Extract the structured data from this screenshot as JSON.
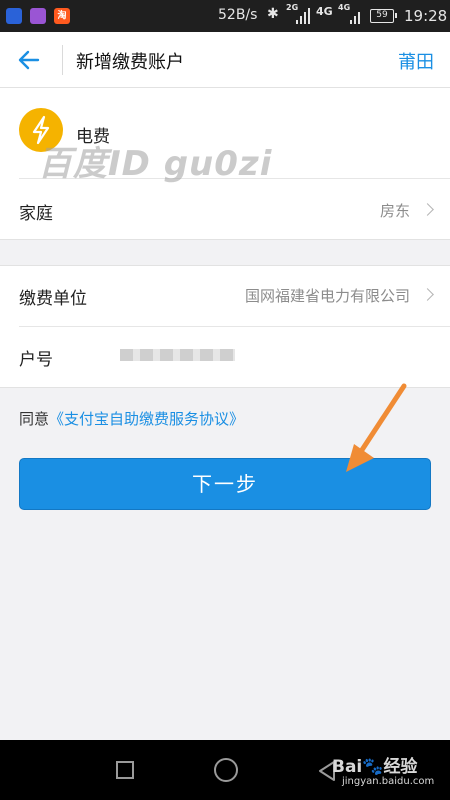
{
  "status_bar": {
    "app_badges": [
      "",
      "",
      "淘"
    ],
    "net_speed": "52B/s",
    "net_2g": "2G",
    "net_4g_a": "4G",
    "net_4g_b": "4G",
    "battery": "59",
    "time": "19:28"
  },
  "header": {
    "title": "新增缴费账户",
    "city": "莆田"
  },
  "bill": {
    "type": "电费",
    "icon": "lightning-bolt-icon",
    "icon_color": "#f5b300"
  },
  "watermark": "百度ID gu0zi",
  "rows": {
    "group_label": "家庭",
    "group_value": "房东",
    "unit_label": "缴费单位",
    "unit_value": "国网福建省电力有限公司",
    "account_label": "户号"
  },
  "agreement": {
    "prefix": "同意",
    "link": "《支付宝自助缴费服务协议》"
  },
  "next_button": "下一步",
  "footer_logo": {
    "brand": "Bai",
    "brand_suffix": "经验",
    "url": "jingyan.baidu.com"
  },
  "colors": {
    "accent": "#1a8fe3",
    "annotation_arrow": "#f08c35"
  }
}
